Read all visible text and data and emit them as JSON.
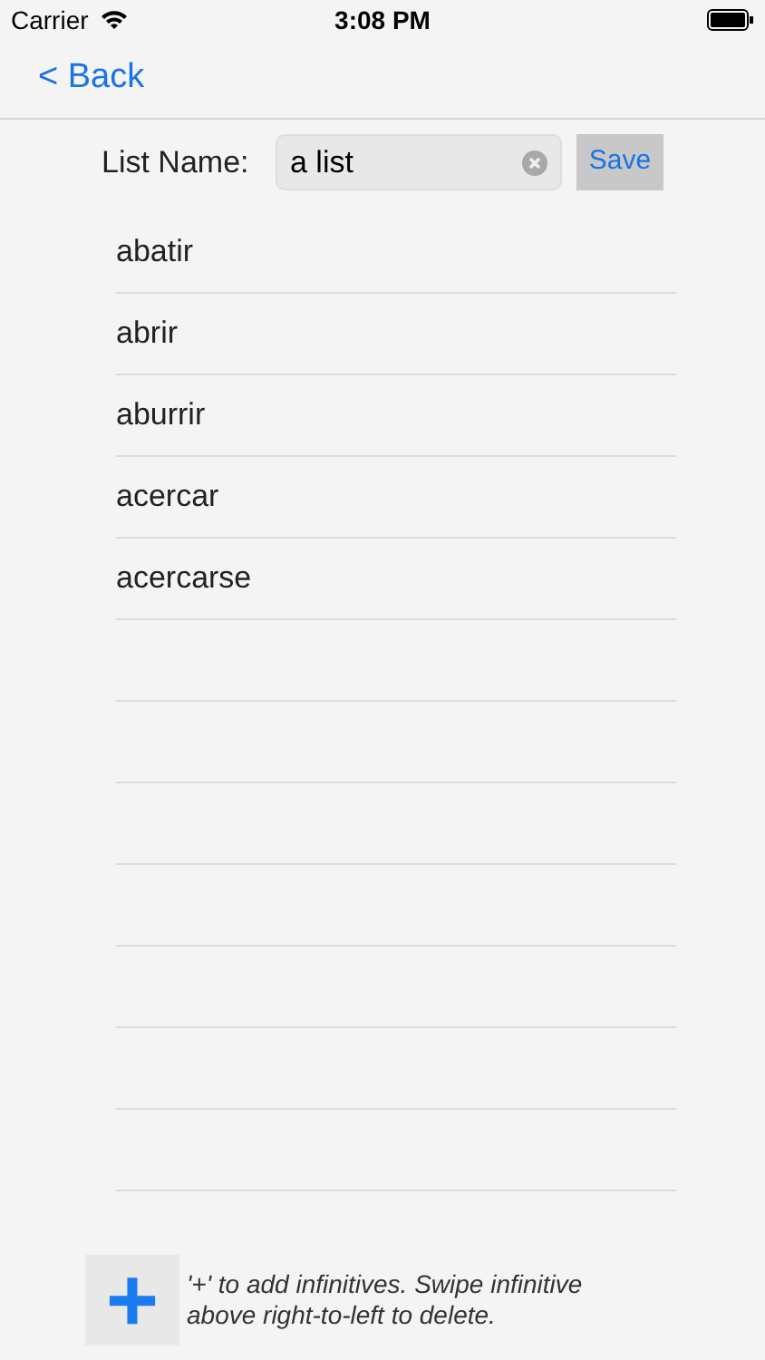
{
  "status_bar": {
    "carrier": "Carrier",
    "time": "3:08 PM"
  },
  "nav": {
    "back": "< Back"
  },
  "list_name": {
    "label": "List Name:",
    "value": "a list",
    "save": "Save"
  },
  "items": [
    {
      "text": "abatir"
    },
    {
      "text": "abrir"
    },
    {
      "text": "aburrir"
    },
    {
      "text": "acercar"
    },
    {
      "text": "acercarse"
    }
  ],
  "footer": {
    "add": "+",
    "hint": "'+' to add infinitives. Swipe infinitive above right-to-left to delete."
  }
}
